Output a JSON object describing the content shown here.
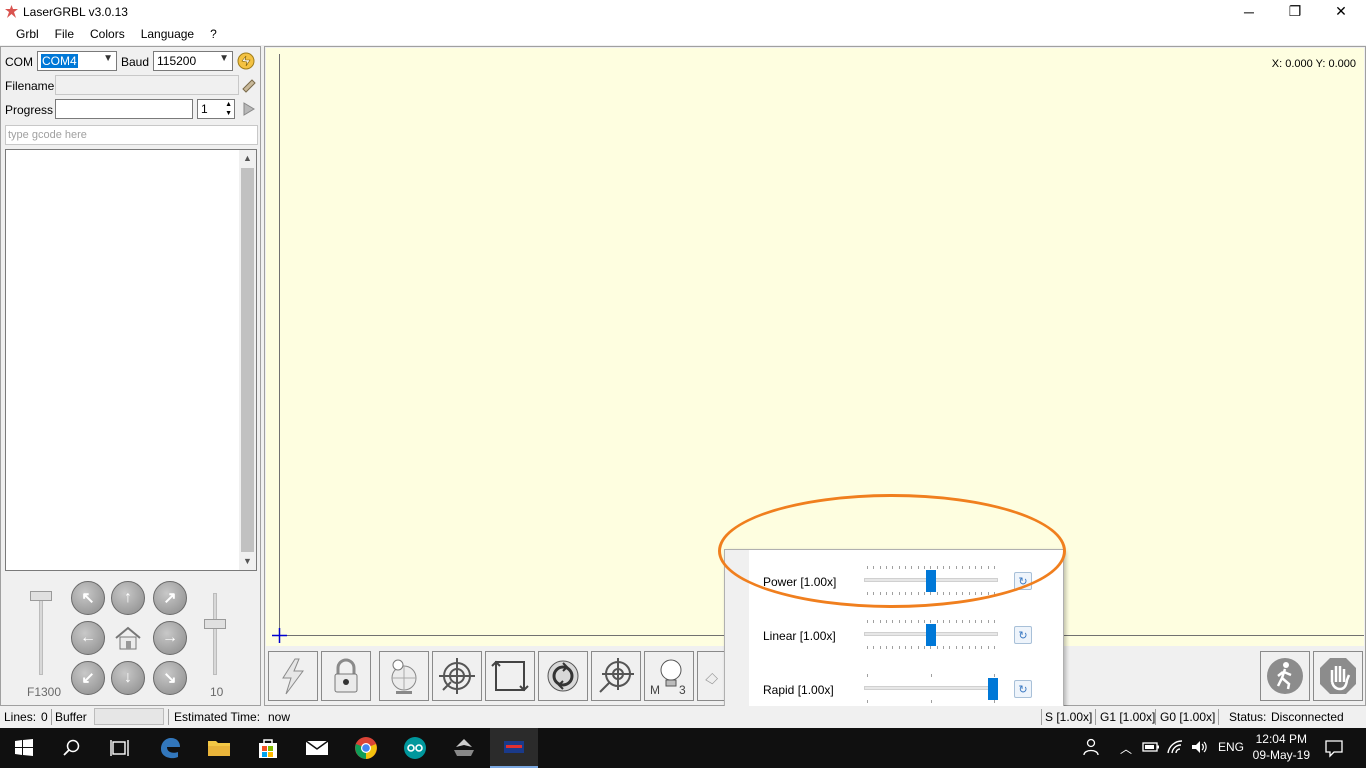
{
  "window": {
    "title": "LaserGRBL v3.0.13",
    "controls": {
      "minimize": "─",
      "maximize": "❐",
      "close": "✕"
    }
  },
  "menu": {
    "items": [
      "Grbl",
      "File",
      "Colors",
      "Language",
      "?"
    ]
  },
  "connection": {
    "com_label": "COM",
    "com_value": "COM4",
    "baud_label": "Baud",
    "baud_value": "115200"
  },
  "file": {
    "filename_label": "Filename",
    "filename_value": "",
    "progress_label": "Progress",
    "progress_value": "",
    "copies_value": "1"
  },
  "gcode": {
    "placeholder": "type gcode here"
  },
  "jog": {
    "speed_label": "F1300",
    "step_label": "10",
    "buttons": [
      "jog-up-left",
      "jog-up",
      "jog-up-right",
      "jog-left",
      "home",
      "jog-right",
      "jog-down-left",
      "jog-down",
      "jog-down-right"
    ]
  },
  "canvas": {
    "coords": "X: 0.000 Y: 0.000"
  },
  "toolbar": {
    "buttons": [
      "reset-grbl",
      "unlock",
      "homing",
      "center",
      "frame",
      "rotate",
      "move-to-origin",
      "user-macro-m3"
    ]
  },
  "overrides": {
    "rows": [
      {
        "label": "Power [1.00x]",
        "value": 1.0,
        "max": 2.0
      },
      {
        "label": "Linear [1.00x]",
        "value": 1.0,
        "max": 2.0
      },
      {
        "label": "Rapid [1.00x]",
        "value": 1.0,
        "max": 1.0
      }
    ],
    "highlight_color": "#f07f1e",
    "slider_color": "#0078d7"
  },
  "status": {
    "lines_label": "Lines:",
    "lines_value": "0",
    "buffer_label": "Buffer",
    "estimated_label": "Estimated Time:",
    "estimated_value": "now",
    "s_override": "S [1.00x]",
    "g1_override": "G1 [1.00x]",
    "g0_override": "G0 [1.00x]",
    "status_label": "Status:",
    "status_value": "Disconnected"
  },
  "taskbar": {
    "lang": "ENG",
    "time": "12:04 PM",
    "date": "09-May-19"
  }
}
